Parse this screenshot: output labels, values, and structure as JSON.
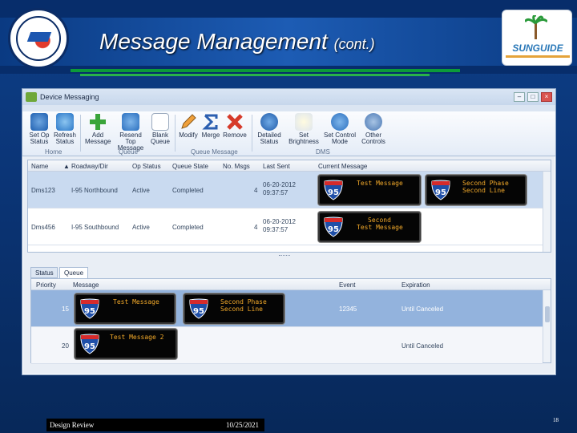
{
  "slide": {
    "title_main": "Message Management",
    "title_sub": "(cont.)",
    "footer_left": "Design Review",
    "footer_date": "10/25/2021",
    "page_number": "18"
  },
  "logo": {
    "word": "SUNGUIDE"
  },
  "window": {
    "title": "Device Messaging"
  },
  "ribbon": {
    "buttons": [
      {
        "label": "Set Op\nStatus",
        "icon": "power-icon"
      },
      {
        "label": "Refresh\nStatus",
        "icon": "refresh-icon"
      },
      {
        "label": "Add\nMessage",
        "icon": "plus-icon"
      },
      {
        "label": "Resend Top\nMessage",
        "icon": "resend-icon"
      },
      {
        "label": "Blank\nQueue",
        "icon": "blank-page-icon"
      },
      {
        "label": "Modify",
        "icon": "pencil-icon"
      },
      {
        "label": "Merge",
        "icon": "sigma-icon"
      },
      {
        "label": "Remove",
        "icon": "x-icon"
      },
      {
        "label": "Detailed\nStatus",
        "icon": "info-icon"
      },
      {
        "label": "Set\nBrightness",
        "icon": "bulb-icon"
      },
      {
        "label": "Set Control\nMode",
        "icon": "phone-icon"
      },
      {
        "label": "Other\nControls",
        "icon": "gear-icon"
      }
    ],
    "groups": [
      "Home",
      "Queue",
      "Queue Message",
      "DMS"
    ]
  },
  "grid1": {
    "columns": [
      "Name",
      "Roadway/Dir",
      "Op Status",
      "Queue State",
      "No. Msgs",
      "Last Sent",
      "Current Message"
    ],
    "rows": [
      {
        "name": "Dms123",
        "roadway": "I-95 Northbound",
        "op": "Active",
        "queue": "Completed",
        "msgs": "4",
        "date": "06-20-2012",
        "time": "09:37:57",
        "signs": [
          [
            "Test Message"
          ],
          [
            "Second Phase",
            "Second Line"
          ]
        ]
      },
      {
        "name": "Dms456",
        "roadway": "I-95 Southbound",
        "op": "Active",
        "queue": "Completed",
        "msgs": "4",
        "date": "06-20-2012",
        "time": "09:37:57",
        "signs": [
          [
            "Second",
            "Test Message"
          ]
        ]
      }
    ]
  },
  "tabs": [
    "Status",
    "Queue"
  ],
  "grid2": {
    "columns": [
      "Priority",
      "Message",
      "Event",
      "Expiration"
    ],
    "rows": [
      {
        "priority": "15",
        "event": "12345",
        "expiration": "Until Canceled",
        "signs": [
          [
            "Test Message"
          ],
          [
            "Second Phase",
            "Second Line"
          ]
        ]
      },
      {
        "priority": "20",
        "event": "",
        "expiration": "Until Canceled",
        "signs": [
          [
            "Test Message 2"
          ]
        ]
      }
    ]
  },
  "shield_number": "95",
  "colors": {
    "led": "#f2a92a",
    "selected_row": "#93b3dd"
  }
}
